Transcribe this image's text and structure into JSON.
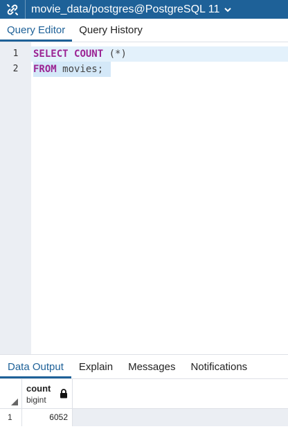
{
  "connection": {
    "title": "movie_data/postgres@PostgreSQL 11"
  },
  "top_tabs": [
    {
      "label": "Query Editor",
      "active": true
    },
    {
      "label": "Query History",
      "active": false
    }
  ],
  "editor": {
    "lines": [
      {
        "number": "1",
        "tokens": {
          "kw1": "SELECT",
          "kw2": "COUNT",
          "rest": " (*)"
        }
      },
      {
        "number": "2",
        "tokens": {
          "kw1": "FROM",
          "rest": " movies;"
        }
      }
    ]
  },
  "bottom_tabs": [
    {
      "label": "Data Output",
      "active": true
    },
    {
      "label": "Explain",
      "active": false
    },
    {
      "label": "Messages",
      "active": false
    },
    {
      "label": "Notifications",
      "active": false
    }
  ],
  "results": {
    "columns": [
      {
        "name": "count",
        "type": "bigint",
        "icon": "lock-icon"
      }
    ],
    "rows": [
      {
        "row_number": "1",
        "values": [
          "6052"
        ]
      }
    ]
  },
  "colors": {
    "accent": "#1e6198",
    "keyword": "#9b2393",
    "gutter": "#ebeef3",
    "line_highlight": "#e3f1fb"
  },
  "icons": {
    "connection": "connection-icon",
    "dropdown": "chevron-down-icon",
    "column_lock": "lock-icon",
    "sort_corner": "corner-triangle-icon"
  }
}
